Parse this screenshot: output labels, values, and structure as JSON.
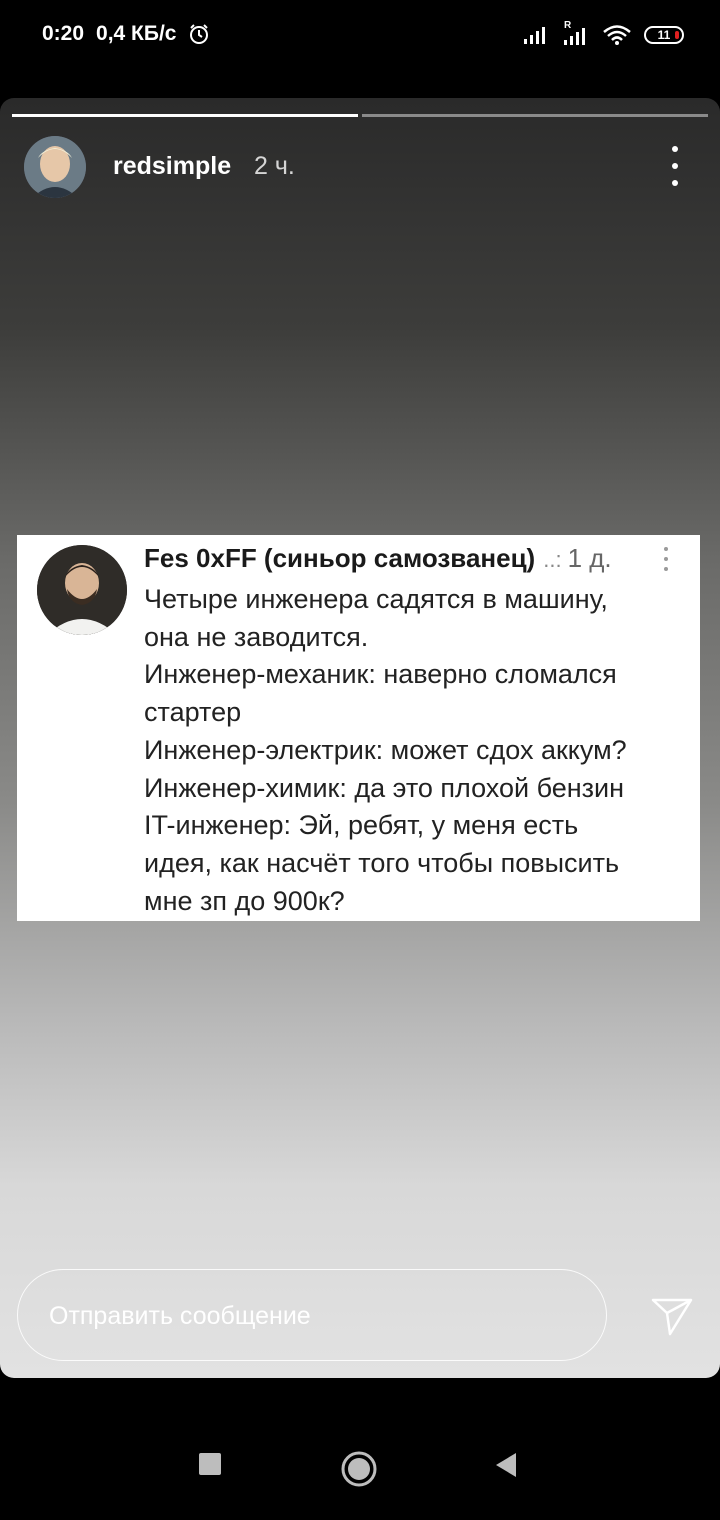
{
  "status_bar": {
    "time": "0:20",
    "speed": "0,4 КБ/с",
    "sim2_label": "R",
    "battery_level": "11",
    "battery_color": "#e02020"
  },
  "story": {
    "progress_segments_total": 2,
    "progress_segments_done": 1,
    "username": "redsimple",
    "time_ago": "2 ч."
  },
  "post": {
    "author": "Fes 0xFF (синьор самозванец)",
    "separator": "..:",
    "time": "1 д.",
    "lines": [
      "Четыре инженера садятся в машину,",
      "она не заводится.",
      "Инженер-механик: наверно сломался",
      "стартер",
      "Инженер-электрик: может сдох аккум?",
      "Инженер-химик: да это плохой бензин",
      "IT-инженер: Эй, ребят, у меня есть",
      "идея, как насчёт того чтобы повысить",
      "мне зп до 900к?"
    ]
  },
  "reply": {
    "placeholder": "Отправить сообщение"
  },
  "icons": {
    "alarm": "alarm-icon",
    "signal": "signal-icon",
    "wifi": "wifi-icon",
    "send": "send-icon",
    "more": "more-vert-icon",
    "recents": "recents-square-icon",
    "home": "home-circle-icon",
    "back": "back-triangle-icon"
  }
}
